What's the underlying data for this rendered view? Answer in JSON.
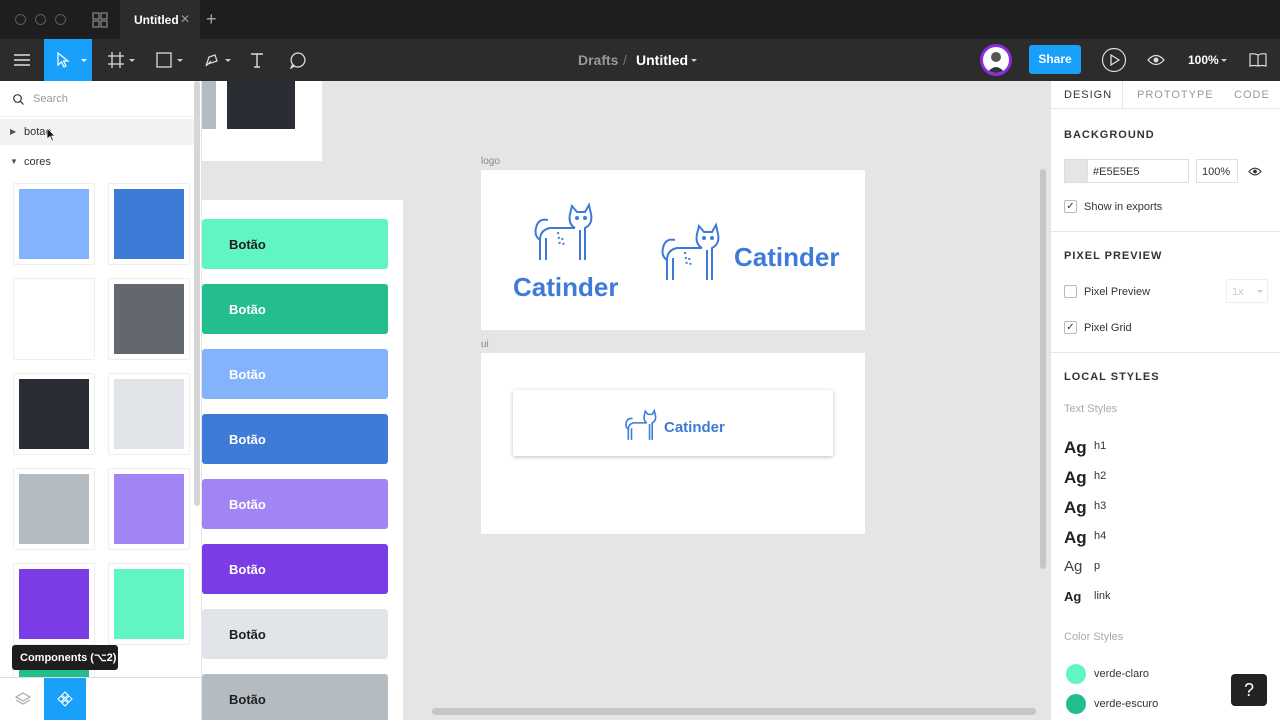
{
  "titlebar": {
    "tab_title": "Untitled",
    "tab_close": "✕",
    "tab_add": "+"
  },
  "toolbar": {
    "breadcrumb_parent": "Drafts",
    "breadcrumb_sep": "/",
    "breadcrumb_file": "Untitled",
    "share_label": "Share",
    "zoom_label": "100%",
    "accent_color": "#18a0fb"
  },
  "left_panel": {
    "search_placeholder": "Search",
    "groups": [
      {
        "label": "botao",
        "expanded": false
      },
      {
        "label": "cores",
        "expanded": true
      }
    ],
    "swatches": [
      "#84b2fb",
      "#3e7bd8",
      "#ffffff",
      "#63676e",
      "#2a2d33",
      "#e1e5e9",
      "#b4bcc2",
      "#a384f5",
      "#7b3ce5",
      "#62f5c4"
    ],
    "tooltip": "Components (⌥2)"
  },
  "canvas": {
    "buttons": [
      {
        "label": "Botão",
        "bg": "#62f5c4",
        "fg": "#1e1e1e"
      },
      {
        "label": "Botão",
        "bg": "#23bd8f",
        "fg": "#ffffff"
      },
      {
        "label": "Botão",
        "bg": "#84b2fb",
        "fg": "#ffffff"
      },
      {
        "label": "Botão",
        "bg": "#3e7bd8",
        "fg": "#ffffff"
      },
      {
        "label": "Botão",
        "bg": "#a384f5",
        "fg": "#ffffff"
      },
      {
        "label": "Botão",
        "bg": "#7b3ce5",
        "fg": "#ffffff"
      },
      {
        "label": "Botão",
        "bg": "#e1e5e9",
        "fg": "#1e1e1e"
      },
      {
        "label": "Botão",
        "bg": "#b4bcc2",
        "fg": "#1e1e1e"
      }
    ],
    "frame_logo_label": "logo",
    "frame_ui_label": "ui",
    "brand_name": "Catinder",
    "brand_color": "#3e7bd8"
  },
  "right_panel": {
    "tabs": [
      "DESIGN",
      "PROTOTYPE",
      "CODE"
    ],
    "background": {
      "title": "BACKGROUND",
      "hex": "#E5E5E5",
      "opacity": "100%",
      "show_in_exports": "Show in exports"
    },
    "pixel_preview": {
      "title": "PIXEL PREVIEW",
      "pixel_preview_label": "Pixel Preview",
      "pixel_preview_scale": "1x",
      "pixel_grid_label": "Pixel Grid"
    },
    "local_styles": {
      "title": "LOCAL STYLES",
      "text_styles_label": "Text Styles",
      "text_styles": [
        {
          "sample": "Ag",
          "name": "h1"
        },
        {
          "sample": "Ag",
          "name": "h2"
        },
        {
          "sample": "Ag",
          "name": "h3"
        },
        {
          "sample": "Ag",
          "name": "h4"
        },
        {
          "sample": "Ag",
          "name": "p"
        },
        {
          "sample": "Ag",
          "name": "link"
        }
      ],
      "color_styles_label": "Color Styles",
      "color_styles": [
        {
          "name": "verde-claro",
          "color": "#62f5c4"
        },
        {
          "name": "verde-escuro",
          "color": "#23bd8f"
        }
      ]
    },
    "help": "?"
  }
}
